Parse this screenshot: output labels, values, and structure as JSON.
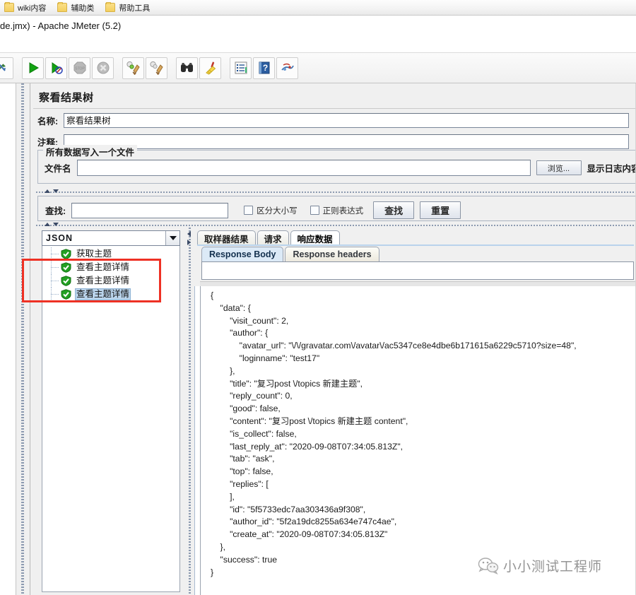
{
  "bookmarks": {
    "items": [
      {
        "label": "wiki内容",
        "icon": "folder-icon"
      },
      {
        "label": "辅助类",
        "icon": "folder-icon"
      },
      {
        "label": "帮助工具",
        "icon": "folder-icon"
      }
    ]
  },
  "window": {
    "title": "de.jmx) - Apache JMeter (5.2)"
  },
  "toolbar": {
    "buttons": [
      {
        "name": "toggle-tree-button",
        "icon": "arrows-icon"
      },
      {
        "name": "start-button",
        "icon": "play-icon"
      },
      {
        "name": "start-no-pauses-button",
        "icon": "play-no-pause-icon"
      },
      {
        "name": "stop-button",
        "icon": "stop-icon"
      },
      {
        "name": "shutdown-button",
        "icon": "shutdown-icon"
      },
      {
        "name": "clear-button",
        "icon": "clear-icon"
      },
      {
        "name": "clear-all-button",
        "icon": "clear-all-icon"
      },
      {
        "name": "search-button",
        "icon": "binoculars-icon"
      },
      {
        "name": "reset-search-button",
        "icon": "broom-icon"
      },
      {
        "name": "function-helper-button",
        "icon": "list-icon"
      },
      {
        "name": "help-button",
        "icon": "help-book-icon"
      },
      {
        "name": "templates-button",
        "icon": "templates-icon"
      }
    ]
  },
  "panel": {
    "title": "察看结果树",
    "name_label": "名称:",
    "name_value": "察看结果树",
    "comment_label": "注释:",
    "comment_value": "",
    "group_legend": "所有数据写入一个文件",
    "filename_label": "文件名",
    "filename_value": "",
    "browse_button": "浏览...",
    "log_display_label": "显示日志内容:"
  },
  "search": {
    "label": "查找:",
    "value": "",
    "case_sensitive_label": "区分大小写",
    "regex_label": "正则表达式",
    "find_button": "查找",
    "reset_button": "重置"
  },
  "tree": {
    "renderer": "JSON",
    "items": [
      {
        "label": "获取主题",
        "status": "success",
        "selected": false
      },
      {
        "label": "查看主题详情",
        "status": "success",
        "selected": false
      },
      {
        "label": "查看主题详情",
        "status": "success",
        "selected": false
      },
      {
        "label": "查看主题详情",
        "status": "success",
        "selected": true
      }
    ]
  },
  "tabs": {
    "main": [
      {
        "label": "取样器结果",
        "active": false
      },
      {
        "label": "请求",
        "active": false
      },
      {
        "label": "响应数据",
        "active": true
      }
    ],
    "sub": [
      {
        "label": "Response Body",
        "active": true
      },
      {
        "label": "Response headers",
        "active": false
      }
    ]
  },
  "response": {
    "search_value": "",
    "body": "{\n    \"data\": {\n        \"visit_count\": 2,\n        \"author\": {\n            \"avatar_url\": \"\\/\\/gravatar.com\\/avatar\\/ac5347ce8e4dbe6b171615a6229c5710?size=48\",\n            \"loginname\": \"test17\"\n        },\n        \"title\": \"复习post \\/topics 新建主题\",\n        \"reply_count\": 0,\n        \"good\": false,\n        \"content\": \"复习post \\/topics 新建主题 content\",\n        \"is_collect\": false,\n        \"last_reply_at\": \"2020-09-08T07:34:05.813Z\",\n        \"tab\": \"ask\",\n        \"top\": false,\n        \"replies\": [\n        ],\n        \"id\": \"5f5733edc7aa303436a9f308\",\n        \"author_id\": \"5f2a19dc8255a634e747c4ae\",\n        \"create_at\": \"2020-09-08T07:34:05.813Z\"\n    },\n    \"success\": true\n}"
  },
  "watermark": {
    "text": "小小测试工程师",
    "icon": "wechat-icon"
  },
  "colors": {
    "accent": "#bad4ec",
    "highlight_box": "#ee3124",
    "success": "#2fa12f",
    "panel_bg": "#f0f0f0"
  }
}
